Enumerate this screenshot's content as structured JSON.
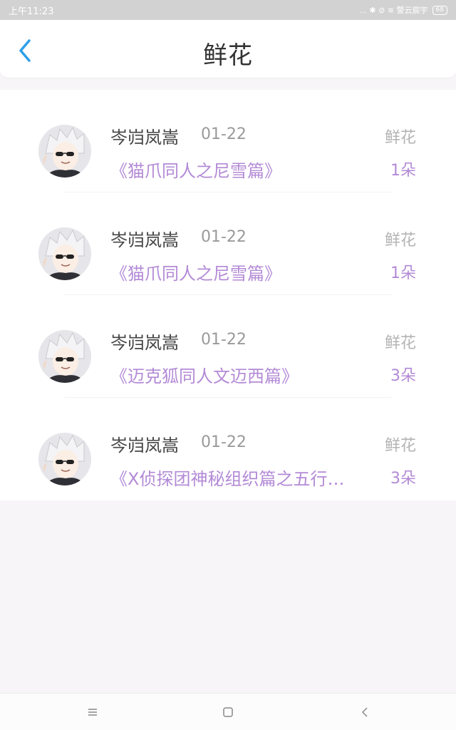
{
  "status_bar": {
    "time": "上午11:23",
    "indicators": "... ✱ ⊘ ≋ 警云宸宇",
    "battery": "68"
  },
  "header": {
    "title": "鲜花",
    "back_icon": "chevron-left-icon"
  },
  "records": [
    {
      "name": "岑岿岚嵩",
      "date": "01-22",
      "book": "《猫爪同人之尼雪篇》",
      "gift": "鲜花",
      "qty": "1朵"
    },
    {
      "name": "岑岿岚嵩",
      "date": "01-22",
      "book": "《猫爪同人之尼雪篇》",
      "gift": "鲜花",
      "qty": "1朵"
    },
    {
      "name": "岑岿岚嵩",
      "date": "01-22",
      "book": "《迈克狐同人文迈西篇》",
      "gift": "鲜花",
      "qty": "3朵"
    },
    {
      "name": "岑岿岚嵩",
      "date": "01-22",
      "book": "《X侦探团神秘组织篇之五行…",
      "gift": "鲜花",
      "qty": "3朵"
    }
  ],
  "nav": {
    "menu_icon": "menu-icon",
    "home_icon": "home-square-icon",
    "back_icon": "back-triangle-icon"
  },
  "colors": {
    "accent": "#2ea0e8",
    "purple": "#b38ad6",
    "grey_text": "#9a9a9a"
  }
}
